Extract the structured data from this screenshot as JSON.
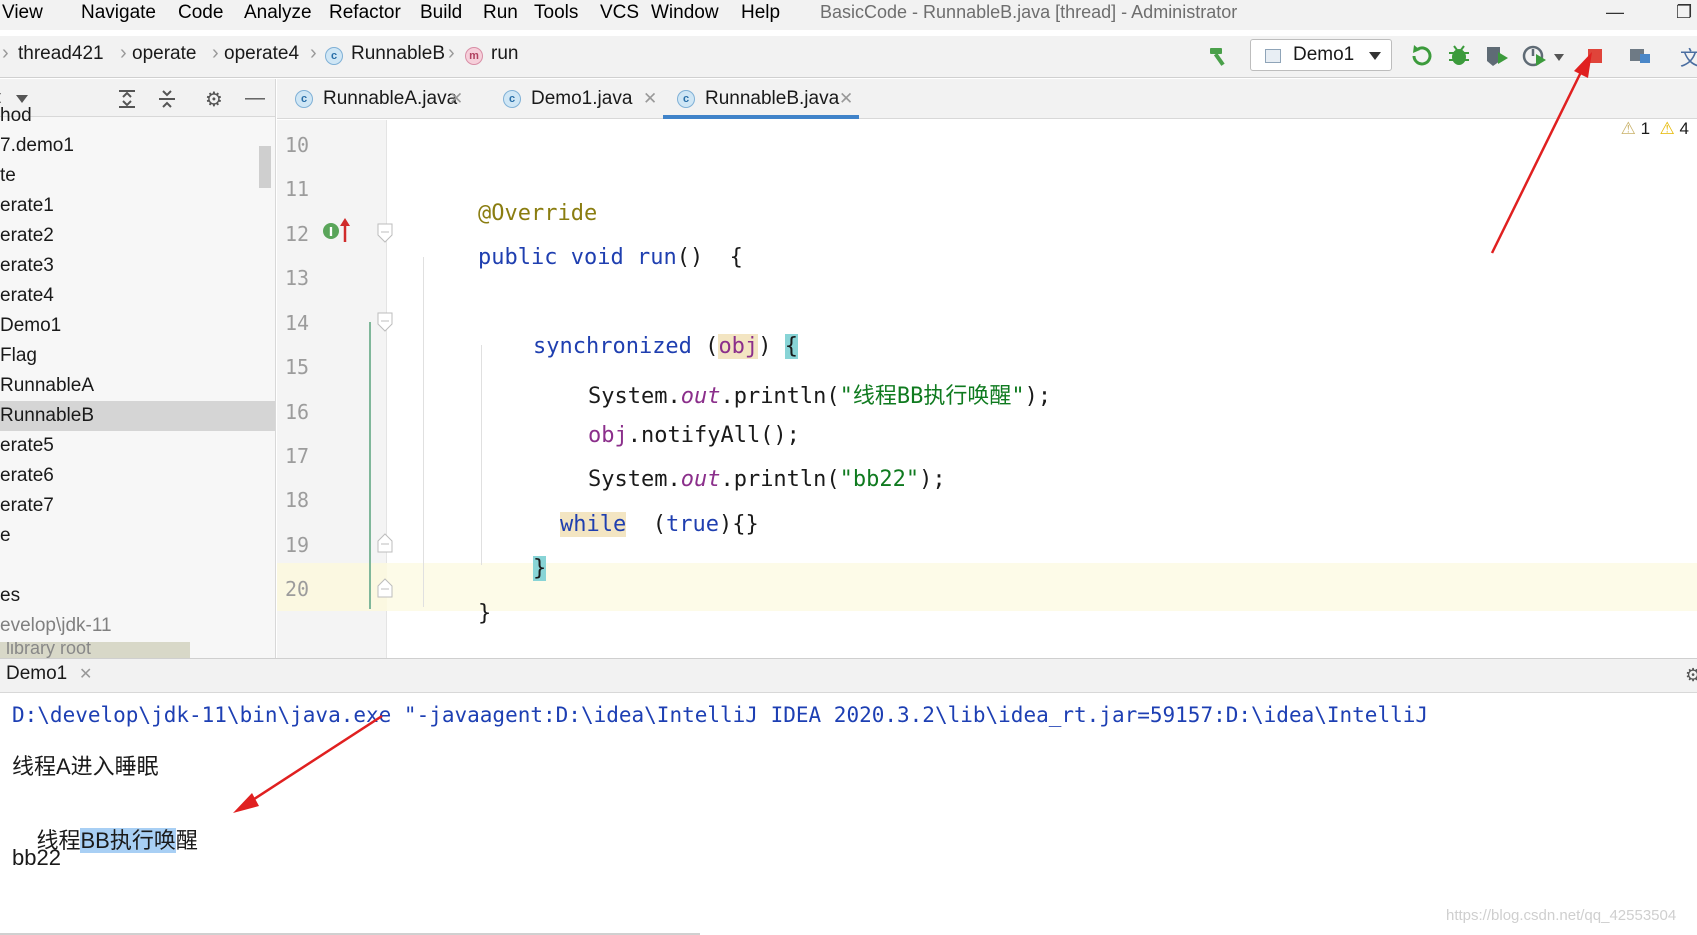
{
  "app": {
    "window_title": "BasicCode - RunnableB.java [thread] - Administrator"
  },
  "menu": {
    "items": [
      {
        "label": "View"
      },
      {
        "label": "Navigate"
      },
      {
        "label": "Code"
      },
      {
        "label": "Analyze"
      },
      {
        "label": "Refactor"
      },
      {
        "label": "Build"
      },
      {
        "label": "Run"
      },
      {
        "label": "Tools"
      },
      {
        "label": "VCS"
      },
      {
        "label": "Window"
      },
      {
        "label": "Help"
      }
    ]
  },
  "breadcrumb": {
    "items": [
      {
        "label": "thread421"
      },
      {
        "label": "operate"
      },
      {
        "label": "operate4"
      },
      {
        "label": "RunnableB",
        "icon": "class-icon"
      },
      {
        "label": "run",
        "icon": "method-icon"
      }
    ]
  },
  "toolbar": {
    "run_config": "Demo1",
    "icons": [
      "build-hammer-icon",
      "rerun-icon",
      "debug-icon",
      "coverage-icon",
      "profile-icon",
      "stop-icon",
      "project-structure-icon",
      "translate-icon"
    ],
    "stop_color": "#e0443a"
  },
  "project_tree": {
    "items": [
      {
        "label": "hod"
      },
      {
        "label": "7.demo1"
      },
      {
        "label": "te"
      },
      {
        "label": "erate1"
      },
      {
        "label": "erate2"
      },
      {
        "label": "erate3"
      },
      {
        "label": "erate4"
      },
      {
        "label": "Demo1"
      },
      {
        "label": "Flag"
      },
      {
        "label": "RunnableA"
      },
      {
        "label": "RunnableB",
        "selected": true
      },
      {
        "label": "erate5"
      },
      {
        "label": "erate6"
      },
      {
        "label": "erate7"
      },
      {
        "label": "e"
      },
      {
        "label": "es"
      },
      {
        "label": "evelop\\jdk-11"
      }
    ],
    "library_root": "library root"
  },
  "editor": {
    "tabs": [
      {
        "label": "RunnableA.java",
        "active": false
      },
      {
        "label": "Demo1.java",
        "active": false
      },
      {
        "label": "RunnableB.java",
        "active": true
      }
    ],
    "inspections": {
      "weak_warnings": "1",
      "warnings": "4"
    },
    "line_numbers": [
      "10",
      "11",
      "12",
      "13",
      "14",
      "15",
      "16",
      "17",
      "18",
      "19",
      "20"
    ],
    "code": {
      "l11_anno": "@Override",
      "l12_kw1": "public",
      "l12_kw2": "void",
      "l12_name": "run",
      "l12_rest": "()  {",
      "l14_kw": "synchronized",
      "l14_open": " (",
      "l14_obj": "obj",
      "l14_close": ")",
      "l14_brace": "{",
      "l15_sys": "System.",
      "l15_out": "out",
      "l15_call": ".println(",
      "l15_str": "\"线程BB执行唤醒\"",
      "l15_end": ");",
      "l16_obj": "obj",
      "l16_rest": ".notifyAll();",
      "l17_sys": "System.",
      "l17_out": "out",
      "l17_call": ".println(",
      "l17_str": "\"bb22\"",
      "l17_end": ");",
      "l18_kw": "while",
      "l18_open": "  (",
      "l18_true": "true",
      "l18_rest": "){}",
      "l19": "}",
      "l20": "}"
    }
  },
  "run_panel": {
    "tab_label": "Demo1",
    "command": "D:\\develop\\jdk-11\\bin\\java.exe \"-javaagent:D:\\idea\\IntelliJ IDEA 2020.3.2\\lib\\idea_rt.jar=59157:D:\\idea\\IntelliJ",
    "output": {
      "line1": "线程A进入睡眠",
      "line2_pre": "线程",
      "line2_sel": "BB执行唤",
      "line2_post": "醒",
      "line3": "bb22"
    },
    "watermark": "https://blog.csdn.net/qq_42553504"
  },
  "colors": {
    "annotation_arrow": "#e02020",
    "active_tab_underline": "#4083c9",
    "selected_tree_row": "#d5d5d5"
  }
}
